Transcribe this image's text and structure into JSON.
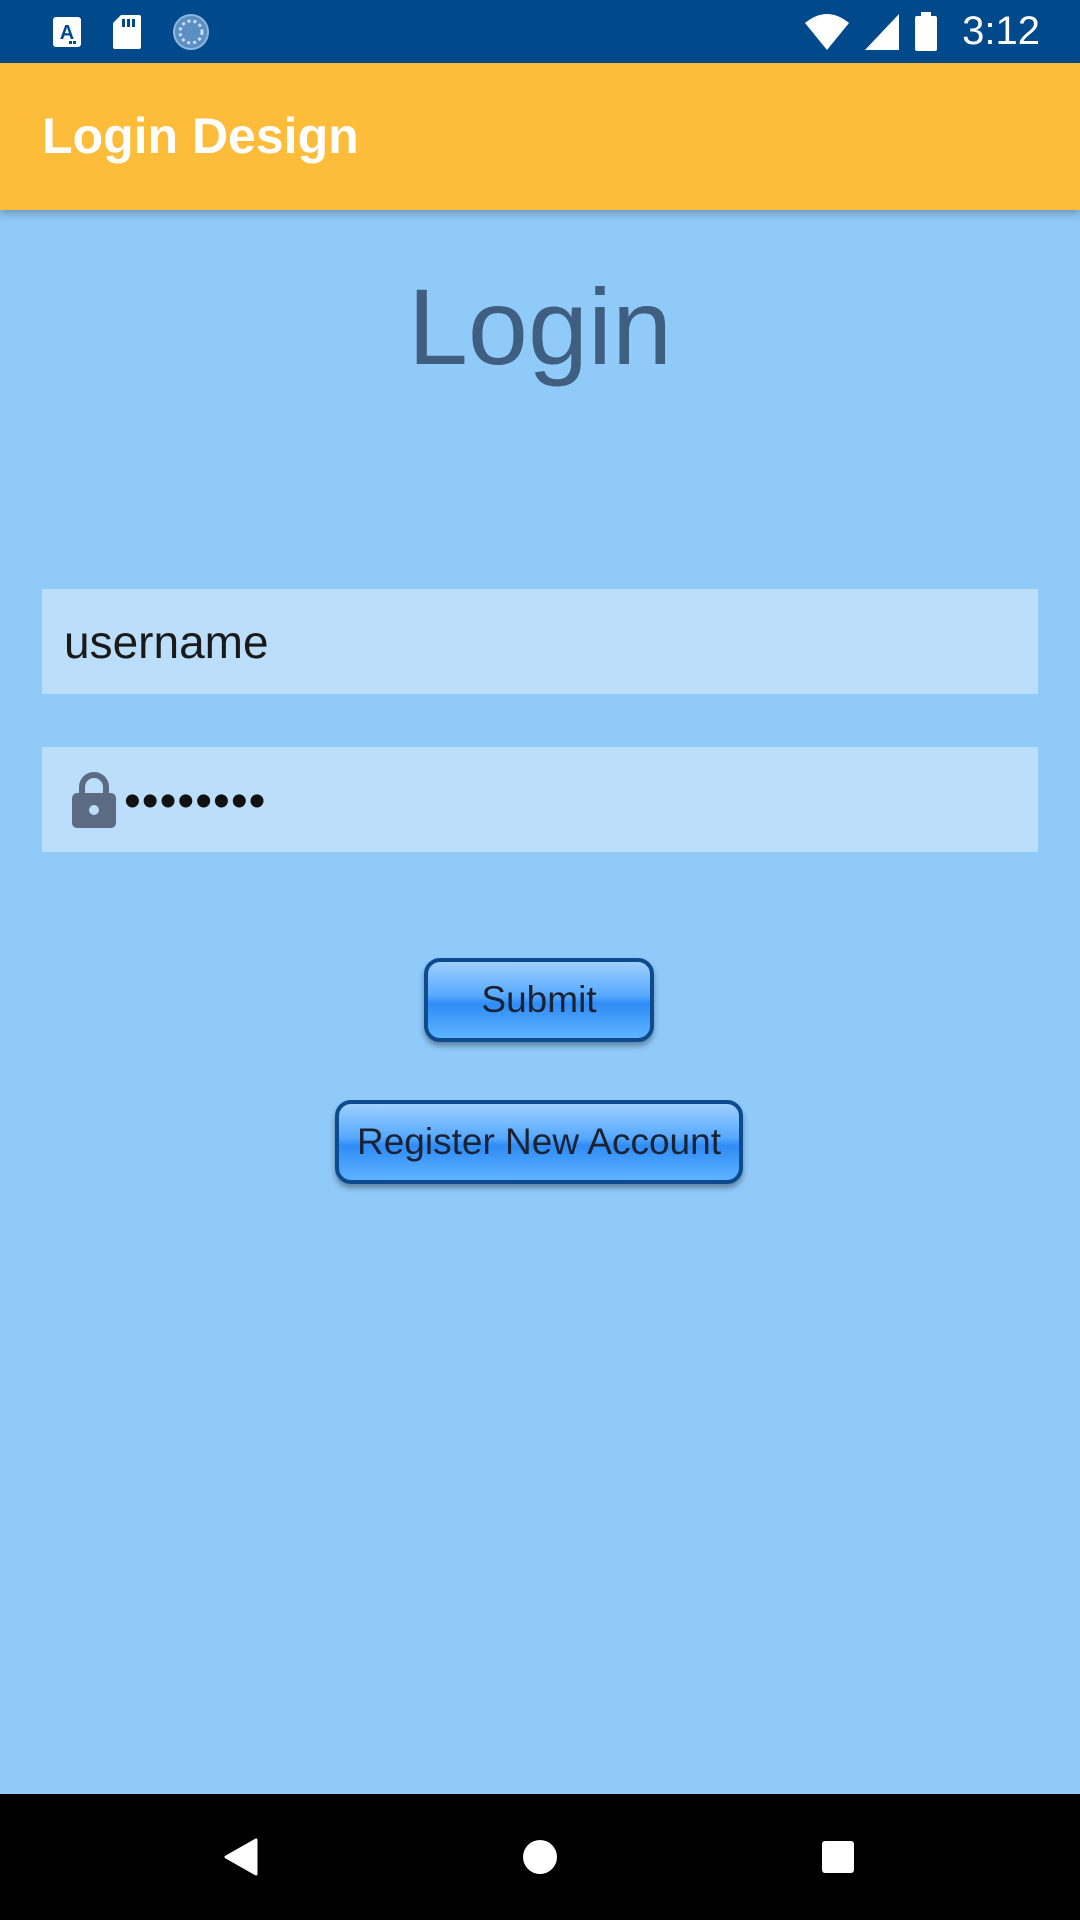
{
  "status_bar": {
    "time": "3:12",
    "left_icons": [
      "font-app-icon",
      "sd-card-icon",
      "sync-icon"
    ],
    "right_icons": [
      "wifi-icon",
      "cellular-signal-icon",
      "battery-icon"
    ]
  },
  "app_bar": {
    "title": "Login Design",
    "background": "#FDBC3A"
  },
  "main": {
    "heading": "Login",
    "username_field": {
      "value": "username"
    },
    "password_field": {
      "value": "••••••••",
      "icon": "lock-icon"
    },
    "submit_label": "Submit",
    "register_label": "Register New Account",
    "background": "#90CAF9"
  },
  "nav_bar": {
    "buttons": [
      "back-icon",
      "home-icon",
      "recents-icon"
    ]
  }
}
